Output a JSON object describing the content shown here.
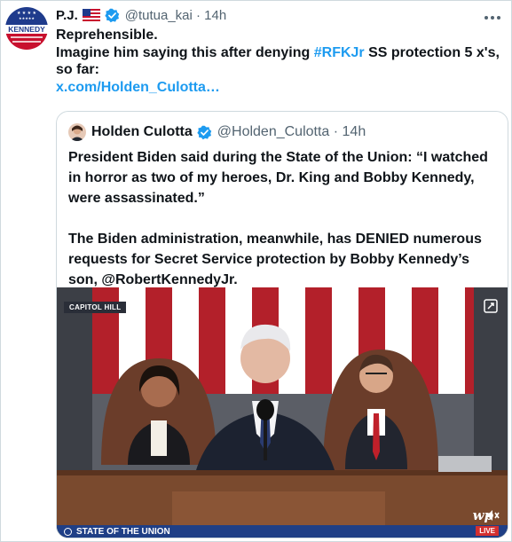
{
  "tweet": {
    "display_name": "P.J.",
    "handle_time": "@tutua_kai · 14h",
    "text_line1": "Reprehensible.",
    "text_line2_before": "Imagine him saying this after denying ",
    "hashtag": "#RFKJr",
    "text_line2_after": " SS protection 5 x's, so far:",
    "link": "x.com/Holden_Culotta…",
    "avatar_text": "KENNEDY"
  },
  "quote": {
    "display_name": "Holden Culotta",
    "handle_time": "@Holden_Culotta · 14h",
    "para1": "President Biden said during the State of the Union: “I watched in horror as two of my heroes, Dr. King and Bobby Kennedy, were assassinated.”",
    "para2": "The Biden administration, meanwhile, has DENIED numerous requests for Secret Service protection by Bobby Kennedy’s son, @RobertKennedyJr."
  },
  "media": {
    "location_tag": "CAPITOL HILL",
    "bottom_caption": "STATE OF THE UNION",
    "logo_text": "wp",
    "live_text": "LIVE"
  },
  "icons": [
    "us-flag-icon",
    "verified-badge-icon",
    "more-icon",
    "expand-icon",
    "mute-icon",
    "play-icon"
  ],
  "colors": {
    "link": "#1d9bf0",
    "verified": "#1d9bf0",
    "text": "#0f1419",
    "muted": "#536471",
    "border": "#cfd9de"
  }
}
